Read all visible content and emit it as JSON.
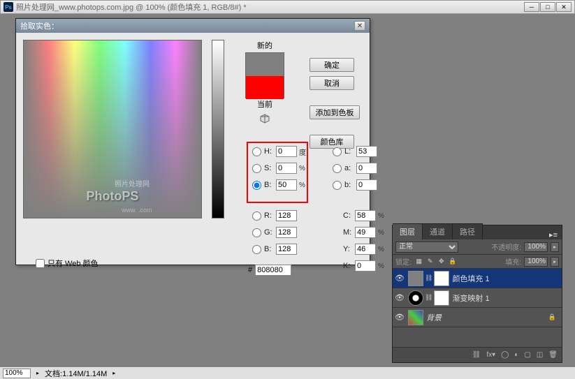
{
  "titlebar": {
    "app_icon": "Ps",
    "title": "照片处理网_www.photops.com.jpg @ 100% (颜色填充 1, RGB/8#) *"
  },
  "color_picker": {
    "title": "拾取实色：",
    "new_label": "新的",
    "current_label": "当前",
    "ok": "确定",
    "cancel": "取消",
    "add_swatch": "添加到色板",
    "color_lib": "颜色库",
    "web_only": "只有 Web 颜色",
    "hex_prefix": "#",
    "hex_value": "808080",
    "watermark_main": "PhotoPS",
    "watermark_sub": "照片处理网",
    "watermark_url": "www.                .com",
    "fields": {
      "H": {
        "label": "H:",
        "value": "0",
        "unit": "度"
      },
      "S": {
        "label": "S:",
        "value": "0",
        "unit": "%"
      },
      "B": {
        "label": "B:",
        "value": "50",
        "unit": "%"
      },
      "L": {
        "label": "L:",
        "value": "53",
        "unit": ""
      },
      "a": {
        "label": "a:",
        "value": "0",
        "unit": ""
      },
      "b": {
        "label": "b:",
        "value": "0",
        "unit": ""
      },
      "R": {
        "label": "R:",
        "value": "128",
        "unit": ""
      },
      "G": {
        "label": "G:",
        "value": "128",
        "unit": ""
      },
      "Bc": {
        "label": "B:",
        "value": "128",
        "unit": ""
      },
      "C": {
        "label": "C:",
        "value": "58",
        "unit": "%"
      },
      "M": {
        "label": "M:",
        "value": "49",
        "unit": "%"
      },
      "Y": {
        "label": "Y:",
        "value": "46",
        "unit": "%"
      },
      "K": {
        "label": "K:",
        "value": "0",
        "unit": "%"
      }
    },
    "preview": {
      "new_color": "#808080",
      "current_color": "#ff0000"
    }
  },
  "layers": {
    "tabs": [
      "图层",
      "通道",
      "路径"
    ],
    "blend_mode": "正常",
    "opacity_label": "不透明度:",
    "opacity": "100%",
    "lock_label": "锁定:",
    "fill_label": "填充:",
    "fill": "100%",
    "items": [
      {
        "name": "颜色填充 1",
        "selected": true,
        "type": "solid"
      },
      {
        "name": "渐变映射 1",
        "selected": false,
        "type": "gradient"
      },
      {
        "name": "背景",
        "selected": false,
        "type": "bg",
        "locked": true
      }
    ]
  },
  "statusbar": {
    "zoom": "100%",
    "doc_label": "文档:",
    "doc_size": "1.14M/1.14M"
  }
}
